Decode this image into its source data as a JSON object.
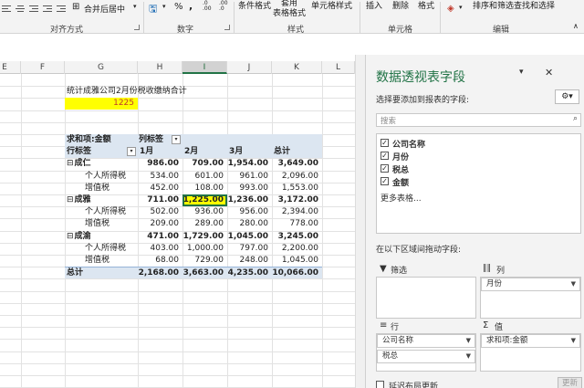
{
  "ribbon": {
    "merge_center": "合并后居中",
    "percent": "%",
    "comma": ",",
    "dec_up": ".0\n.00",
    "dec_down": ".00\n.0",
    "cond_format": "条件格式",
    "table_format": "套用\n表格格式",
    "cell_style": "单元格样式",
    "insert": "插入",
    "delete": "删除",
    "format": "格式",
    "sort_filter": "排序和筛选",
    "find_select": "查找和选择",
    "groups": {
      "alignment": "对齐方式",
      "number": "数字",
      "styles": "样式",
      "cells": "单元格",
      "editing": "编辑"
    }
  },
  "columns": [
    "E",
    "F",
    "G",
    "H",
    "I",
    "J",
    "K",
    "L"
  ],
  "sheet": {
    "title": "统计成雅公司2月份税收缴纳合计",
    "value": "1225"
  },
  "pivot": {
    "header1_label": "求和项:金额",
    "header1_col": "列标签",
    "header2_label": "行标签",
    "col_headers": [
      "1月",
      "2月",
      "3月",
      "总计"
    ],
    "groups": [
      {
        "name": "成仁",
        "values": [
          "986.00",
          "709.00",
          "1,954.00",
          "3,649.00"
        ],
        "children": [
          {
            "name": "个人所得税",
            "values": [
              "534.00",
              "601.00",
              "961.00",
              "2,096.00"
            ]
          },
          {
            "name": "增值税",
            "values": [
              "452.00",
              "108.00",
              "993.00",
              "1,553.00"
            ]
          }
        ]
      },
      {
        "name": "成雅",
        "values": [
          "711.00",
          "1,225.00",
          "1,236.00",
          "3,172.00"
        ],
        "children": [
          {
            "name": "个人所得税",
            "values": [
              "502.00",
              "936.00",
              "956.00",
              "2,394.00"
            ]
          },
          {
            "name": "增值税",
            "values": [
              "209.00",
              "289.00",
              "280.00",
              "778.00"
            ]
          }
        ]
      },
      {
        "name": "成渝",
        "values": [
          "471.00",
          "1,729.00",
          "1,045.00",
          "3,245.00"
        ],
        "children": [
          {
            "name": "个人所得税",
            "values": [
              "403.00",
              "1,000.00",
              "797.00",
              "2,200.00"
            ]
          },
          {
            "name": "增值税",
            "values": [
              "68.00",
              "729.00",
              "248.00",
              "1,045.00"
            ]
          }
        ]
      }
    ],
    "total_label": "总计",
    "total_values": [
      "2,168.00",
      "3,663.00",
      "4,235.00",
      "10,066.00"
    ]
  },
  "panel": {
    "title": "数据透视表字段",
    "subtitle": "选择要添加到报表的字段:",
    "search_placeholder": "搜索",
    "fields": [
      {
        "label": "公司名称",
        "checked": true
      },
      {
        "label": "月份",
        "checked": true
      },
      {
        "label": "税总",
        "checked": true
      },
      {
        "label": "金额",
        "checked": true
      }
    ],
    "more_tables": "更多表格...",
    "drag_hint": "在以下区域间拖动字段:",
    "zones": {
      "filter": "筛选",
      "columns": "列",
      "rows": "行",
      "values": "值"
    },
    "col_pill": "月份",
    "row_pills": [
      "公司名称",
      "税总"
    ],
    "value_pill": "求和项:金额",
    "defer_label": "延迟布局更新",
    "update_button": "更新"
  },
  "colors": {
    "pivot_header": "#dce6f1",
    "highlight": "#ffff00",
    "accent": "#217346"
  }
}
